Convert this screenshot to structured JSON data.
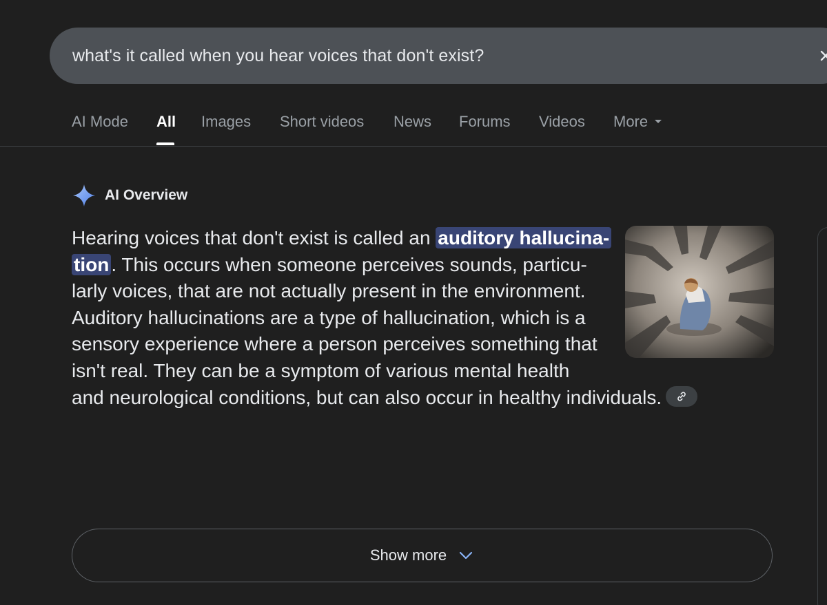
{
  "search": {
    "query": "what's it called when you hear voices that don't exist?"
  },
  "tabs": [
    {
      "label": "AI Mode"
    },
    {
      "label": "All"
    },
    {
      "label": "Images"
    },
    {
      "label": "Short videos"
    },
    {
      "label": "News"
    },
    {
      "label": "Forums"
    },
    {
      "label": "Videos"
    },
    {
      "label": "More"
    }
  ],
  "overview": {
    "title": "AI Overview",
    "lines": [
      {
        "before": "Hearing voices that don't exist is called an ",
        "highlight": "auditory hallucina-"
      },
      {
        "highlight": "tion",
        "after": ". This occurs when someone perceives sounds, particu-"
      },
      {
        "text": "larly voices, that are not actually present in the environment."
      },
      {
        "text": "Auditory hallucinations are a type of hallucination, which is a"
      },
      {
        "text": "sensory experience where a person perceives something that"
      },
      {
        "text": "isn't real. They can be a symptom of various mental health"
      },
      {
        "text": "and neurological conditions, but can also occur in healthy individuals."
      }
    ]
  },
  "show_more": {
    "label": "Show more"
  },
  "colors": {
    "background": "#1f1f1f",
    "search_bg": "#4d5156",
    "highlight_bg": "#394575",
    "sparkle": "#8ab4f8"
  },
  "icons": {
    "sparkle": "sparkle-icon",
    "clear": "close-icon",
    "link": "link-icon",
    "chevron": "chevron-down-icon"
  }
}
